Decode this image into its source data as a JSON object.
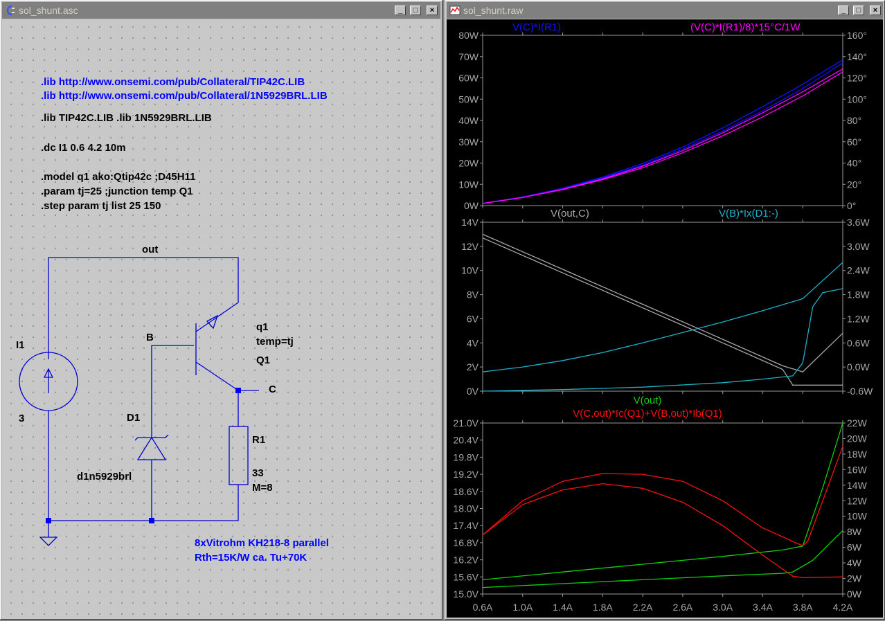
{
  "schematic_window": {
    "title": "sol_shunt.asc",
    "buttons": {
      "minimize": "_",
      "maximize": "□",
      "close": "×"
    },
    "directives": {
      "lib_url1": ".lib http://www.onsemi.com/pub/Collateral/TIP42C.LIB",
      "lib_url2": ".lib http://www.onsemi.com/pub/Collateral/1N5929BRL.LIB",
      "lib_local": ".lib TIP42C.LIB  .lib 1N5929BRL.LIB",
      "dc": ".dc I1 0.6 4.2 10m",
      "model": ".model q1 ako:Qtip42c ;D45H11",
      "param": ".param tj=25 ;junction temp Q1",
      "step": ".step param tj list 25 150"
    },
    "labels": {
      "net_out": "out",
      "net_b": "B",
      "net_c": "C",
      "i1_name": "I1",
      "i1_value": "3",
      "q_inst": "q1",
      "q_temp": "temp=tj",
      "q_name": "Q1",
      "d_name": "D1",
      "d_value": "d1n5929brl",
      "r_name": "R1",
      "r_value": "33",
      "r_mult": "M=8"
    },
    "note": {
      "line1": "8xVitrohm KH218-8 parallel",
      "line2": "Rth=15K/W  ca. Tu+70K"
    }
  },
  "waveform_window": {
    "title": "sol_shunt.raw",
    "buttons": {
      "minimize": "_",
      "maximize": "□",
      "close": "×"
    }
  },
  "chart_data": [
    {
      "type": "line",
      "pane": "top",
      "x_range": [
        0.6,
        4.2
      ],
      "ylim_left": [
        0,
        80
      ],
      "ylim_right": [
        0,
        160
      ],
      "left_ticks": [
        "80W",
        "70W",
        "60W",
        "50W",
        "40W",
        "30W",
        "20W",
        "10W",
        "0W"
      ],
      "right_ticks": [
        "160°",
        "140°",
        "120°",
        "100°",
        "80°",
        "60°",
        "40°",
        "20°",
        "0°"
      ],
      "traces": [
        {
          "label": "V(C)*I(R1)",
          "color": "#1010ff",
          "axis": "left",
          "steps": [
            {
              "x": [
                0.6,
                1.0,
                1.4,
                1.8,
                2.2,
                2.6,
                3.0,
                3.4,
                3.8,
                4.2
              ],
              "y": [
                1.1,
                4.0,
                8.0,
                13.0,
                19.0,
                26.5,
                35.0,
                44.5,
                55.0,
                67.0
              ]
            },
            {
              "x": [
                0.6,
                1.0,
                1.4,
                1.8,
                2.2,
                2.6,
                3.0,
                3.4,
                3.8,
                4.2
              ],
              "y": [
                1.1,
                4.1,
                8.2,
                13.4,
                19.8,
                27.5,
                36.5,
                46.5,
                57.0,
                68.5
              ]
            }
          ]
        },
        {
          "label": "(V(C)*I(R1)/8)*15°C/1W",
          "color": "#ff00ff",
          "axis": "right",
          "steps": [
            {
              "x": [
                0.6,
                1.0,
                1.4,
                1.8,
                2.2,
                2.6,
                3.0,
                3.4,
                3.8,
                4.2
              ],
              "y": [
                2.0,
                7.6,
                15.0,
                24.4,
                35.6,
                49.6,
                65.6,
                83.4,
                103.0,
                125.6
              ]
            },
            {
              "x": [
                0.6,
                1.0,
                1.4,
                1.8,
                2.2,
                2.6,
                3.0,
                3.4,
                3.8,
                4.2
              ],
              "y": [
                2.0,
                7.7,
                15.4,
                25.1,
                37.1,
                51.6,
                68.4,
                87.2,
                106.9,
                128.4
              ]
            }
          ]
        }
      ]
    },
    {
      "type": "line",
      "pane": "middle",
      "x_range": [
        0.6,
        4.2
      ],
      "ylim_left": [
        0,
        14
      ],
      "ylim_right": [
        -0.6,
        3.6
      ],
      "left_ticks": [
        "14V",
        "12V",
        "10V",
        "8V",
        "6V",
        "4V",
        "2V",
        "0V"
      ],
      "right_ticks": [
        "3.6W",
        "3.0W",
        "2.4W",
        "1.8W",
        "1.2W",
        "0.6W",
        "0.0W",
        "-0.6W"
      ],
      "traces": [
        {
          "label": "V(out,C)",
          "color": "#a8a8a8",
          "axis": "left",
          "steps": [
            {
              "x": [
                0.6,
                1.4,
                2.2,
                3.0,
                3.6,
                3.8,
                4.2
              ],
              "y": [
                13.0,
                10.1,
                7.2,
                4.3,
                2.1,
                1.6,
                4.8
              ]
            },
            {
              "x": [
                0.6,
                1.4,
                2.2,
                3.0,
                3.6,
                3.7,
                4.2
              ],
              "y": [
                12.7,
                9.8,
                6.9,
                4.0,
                1.8,
                0.5,
                0.5
              ]
            }
          ]
        },
        {
          "label": "V(B)*Ix(D1:-)",
          "color": "#20b0c8",
          "axis": "right",
          "steps": [
            {
              "x": [
                0.6,
                1.0,
                1.4,
                1.8,
                2.2,
                2.6,
                3.0,
                3.4,
                3.8,
                4.0,
                4.2
              ],
              "y": [
                -0.12,
                0.0,
                0.16,
                0.36,
                0.6,
                0.86,
                1.12,
                1.4,
                1.7,
                2.15,
                2.6
              ]
            },
            {
              "x": [
                0.6,
                1.4,
                2.2,
                3.0,
                3.4,
                3.7,
                3.8,
                3.9,
                4.0,
                4.2
              ],
              "y": [
                -0.6,
                -0.56,
                -0.5,
                -0.39,
                -0.3,
                -0.22,
                0.1,
                1.5,
                1.85,
                1.95
              ]
            }
          ]
        }
      ]
    },
    {
      "type": "line",
      "pane": "bottom",
      "x_range": [
        0.6,
        4.2
      ],
      "xticks": [
        "0.6A",
        "1.0A",
        "1.4A",
        "1.8A",
        "2.2A",
        "2.6A",
        "3.0A",
        "3.4A",
        "3.8A",
        "4.2A"
      ],
      "ylim_left": [
        15.0,
        21.6
      ],
      "ylim_right": [
        0,
        22
      ],
      "left_ticks": [
        "21.0V",
        "20.4V",
        "19.8V",
        "19.2V",
        "18.6V",
        "18.0V",
        "17.4V",
        "16.8V",
        "16.2V",
        "15.6V",
        "15.0V"
      ],
      "right_ticks": [
        "22W",
        "20W",
        "18W",
        "16W",
        "14W",
        "12W",
        "10W",
        "8W",
        "6W",
        "4W",
        "2W",
        "0W"
      ],
      "traces": [
        {
          "label": "V(out)",
          "color": "#10d010",
          "axis": "left",
          "steps": [
            {
              "x": [
                0.6,
                1.4,
                2.2,
                3.0,
                3.6,
                3.8,
                4.0,
                4.2
              ],
              "y": [
                15.55,
                15.85,
                16.15,
                16.45,
                16.7,
                16.85,
                19.1,
                21.6
              ]
            },
            {
              "x": [
                0.6,
                1.4,
                2.2,
                3.0,
                3.6,
                3.7,
                3.9,
                4.2
              ],
              "y": [
                15.25,
                15.4,
                15.55,
                15.7,
                15.8,
                15.85,
                16.3,
                17.45
              ]
            }
          ]
        },
        {
          "label": "V(C,out)*Ic(Q1)+V(B,out)*Ib(Q1)",
          "color": "#ff1010",
          "axis": "right",
          "steps": [
            {
              "x": [
                0.6,
                1.0,
                1.4,
                1.8,
                2.2,
                2.6,
                3.0,
                3.4,
                3.8,
                3.85,
                4.0,
                4.2
              ],
              "y": [
                7.6,
                12.0,
                14.5,
                15.5,
                15.4,
                14.5,
                12.0,
                8.5,
                6.2,
                6.8,
                12.0,
                19.0
              ]
            },
            {
              "x": [
                0.6,
                1.0,
                1.4,
                1.8,
                2.2,
                2.6,
                3.0,
                3.4,
                3.7,
                3.8,
                4.2
              ],
              "y": [
                7.6,
                11.5,
                13.4,
                14.2,
                13.6,
                11.8,
                8.8,
                5.0,
                2.3,
                2.1,
                2.2
              ]
            }
          ]
        }
      ]
    }
  ]
}
